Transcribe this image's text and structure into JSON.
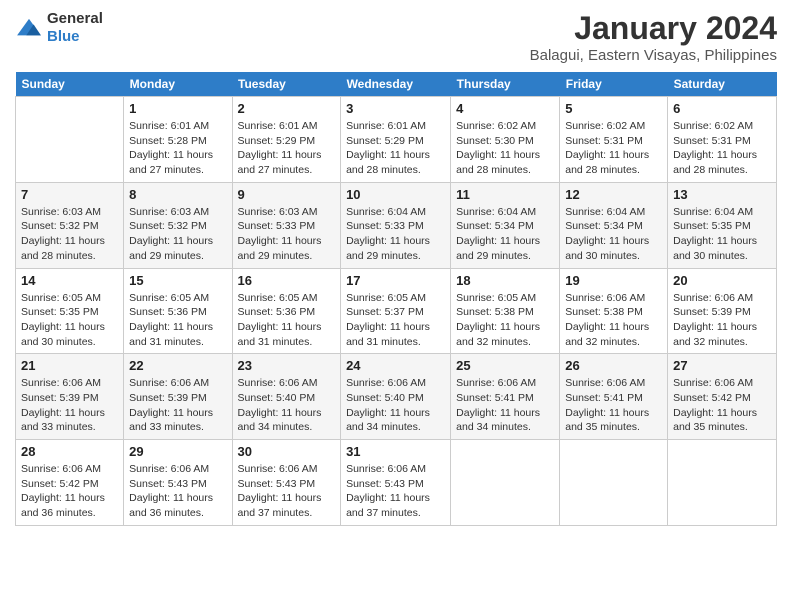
{
  "logo": {
    "general": "General",
    "blue": "Blue"
  },
  "title": "January 2024",
  "subtitle": "Balagui, Eastern Visayas, Philippines",
  "header": {
    "days": [
      "Sunday",
      "Monday",
      "Tuesday",
      "Wednesday",
      "Thursday",
      "Friday",
      "Saturday"
    ]
  },
  "weeks": [
    [
      null,
      {
        "day": "1",
        "sunrise": "6:01 AM",
        "sunset": "5:28 PM",
        "daylight": "11 hours and 27 minutes."
      },
      {
        "day": "2",
        "sunrise": "6:01 AM",
        "sunset": "5:29 PM",
        "daylight": "11 hours and 27 minutes."
      },
      {
        "day": "3",
        "sunrise": "6:01 AM",
        "sunset": "5:29 PM",
        "daylight": "11 hours and 28 minutes."
      },
      {
        "day": "4",
        "sunrise": "6:02 AM",
        "sunset": "5:30 PM",
        "daylight": "11 hours and 28 minutes."
      },
      {
        "day": "5",
        "sunrise": "6:02 AM",
        "sunset": "5:31 PM",
        "daylight": "11 hours and 28 minutes."
      },
      {
        "day": "6",
        "sunrise": "6:02 AM",
        "sunset": "5:31 PM",
        "daylight": "11 hours and 28 minutes."
      }
    ],
    [
      {
        "day": "7",
        "sunrise": "6:03 AM",
        "sunset": "5:32 PM",
        "daylight": "11 hours and 28 minutes."
      },
      {
        "day": "8",
        "sunrise": "6:03 AM",
        "sunset": "5:32 PM",
        "daylight": "11 hours and 29 minutes."
      },
      {
        "day": "9",
        "sunrise": "6:03 AM",
        "sunset": "5:33 PM",
        "daylight": "11 hours and 29 minutes."
      },
      {
        "day": "10",
        "sunrise": "6:04 AM",
        "sunset": "5:33 PM",
        "daylight": "11 hours and 29 minutes."
      },
      {
        "day": "11",
        "sunrise": "6:04 AM",
        "sunset": "5:34 PM",
        "daylight": "11 hours and 29 minutes."
      },
      {
        "day": "12",
        "sunrise": "6:04 AM",
        "sunset": "5:34 PM",
        "daylight": "11 hours and 30 minutes."
      },
      {
        "day": "13",
        "sunrise": "6:04 AM",
        "sunset": "5:35 PM",
        "daylight": "11 hours and 30 minutes."
      }
    ],
    [
      {
        "day": "14",
        "sunrise": "6:05 AM",
        "sunset": "5:35 PM",
        "daylight": "11 hours and 30 minutes."
      },
      {
        "day": "15",
        "sunrise": "6:05 AM",
        "sunset": "5:36 PM",
        "daylight": "11 hours and 31 minutes."
      },
      {
        "day": "16",
        "sunrise": "6:05 AM",
        "sunset": "5:36 PM",
        "daylight": "11 hours and 31 minutes."
      },
      {
        "day": "17",
        "sunrise": "6:05 AM",
        "sunset": "5:37 PM",
        "daylight": "11 hours and 31 minutes."
      },
      {
        "day": "18",
        "sunrise": "6:05 AM",
        "sunset": "5:38 PM",
        "daylight": "11 hours and 32 minutes."
      },
      {
        "day": "19",
        "sunrise": "6:06 AM",
        "sunset": "5:38 PM",
        "daylight": "11 hours and 32 minutes."
      },
      {
        "day": "20",
        "sunrise": "6:06 AM",
        "sunset": "5:39 PM",
        "daylight": "11 hours and 32 minutes."
      }
    ],
    [
      {
        "day": "21",
        "sunrise": "6:06 AM",
        "sunset": "5:39 PM",
        "daylight": "11 hours and 33 minutes."
      },
      {
        "day": "22",
        "sunrise": "6:06 AM",
        "sunset": "5:39 PM",
        "daylight": "11 hours and 33 minutes."
      },
      {
        "day": "23",
        "sunrise": "6:06 AM",
        "sunset": "5:40 PM",
        "daylight": "11 hours and 34 minutes."
      },
      {
        "day": "24",
        "sunrise": "6:06 AM",
        "sunset": "5:40 PM",
        "daylight": "11 hours and 34 minutes."
      },
      {
        "day": "25",
        "sunrise": "6:06 AM",
        "sunset": "5:41 PM",
        "daylight": "11 hours and 34 minutes."
      },
      {
        "day": "26",
        "sunrise": "6:06 AM",
        "sunset": "5:41 PM",
        "daylight": "11 hours and 35 minutes."
      },
      {
        "day": "27",
        "sunrise": "6:06 AM",
        "sunset": "5:42 PM",
        "daylight": "11 hours and 35 minutes."
      }
    ],
    [
      {
        "day": "28",
        "sunrise": "6:06 AM",
        "sunset": "5:42 PM",
        "daylight": "11 hours and 36 minutes."
      },
      {
        "day": "29",
        "sunrise": "6:06 AM",
        "sunset": "5:43 PM",
        "daylight": "11 hours and 36 minutes."
      },
      {
        "day": "30",
        "sunrise": "6:06 AM",
        "sunset": "5:43 PM",
        "daylight": "11 hours and 37 minutes."
      },
      {
        "day": "31",
        "sunrise": "6:06 AM",
        "sunset": "5:43 PM",
        "daylight": "11 hours and 37 minutes."
      },
      null,
      null,
      null
    ]
  ]
}
